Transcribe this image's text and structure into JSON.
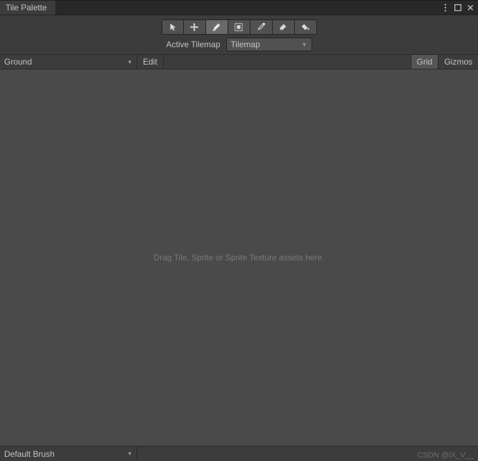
{
  "window": {
    "tab_title": "Tile Palette"
  },
  "toolbar": {
    "tools": [
      {
        "name": "select",
        "active": false
      },
      {
        "name": "move",
        "active": false
      },
      {
        "name": "paint",
        "active": true
      },
      {
        "name": "box-fill",
        "active": false
      },
      {
        "name": "picker",
        "active": false
      },
      {
        "name": "eraser",
        "active": false
      },
      {
        "name": "flood-fill",
        "active": false
      }
    ],
    "active_tilemap_label": "Active Tilemap",
    "active_tilemap_value": "Tilemap"
  },
  "subbar": {
    "palette_value": "Ground",
    "edit_label": "Edit",
    "grid_label": "Grid",
    "grid_active": true,
    "gizmos_label": "Gizmos"
  },
  "canvas": {
    "hint": "Drag Tile, Sprite or Sprite Texture assets here."
  },
  "footer": {
    "brush_value": "Default Brush",
    "watermark": "CSDN @IX_V__"
  }
}
